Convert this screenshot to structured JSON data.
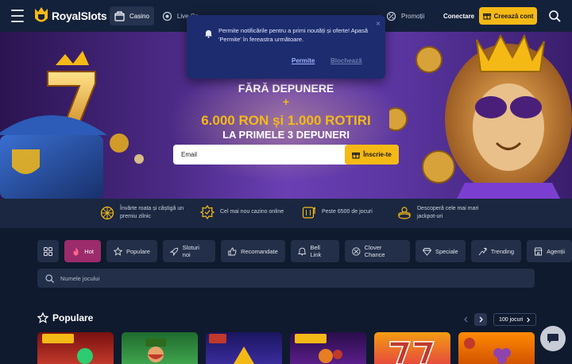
{
  "brand": {
    "name": "RoyalSlots"
  },
  "nav": {
    "items": [
      {
        "label": "Casino",
        "icon": "casino-icon"
      },
      {
        "label": "Live Ca",
        "icon": "live-casino-icon"
      },
      {
        "label": "Promoții",
        "icon": "promotions-icon"
      }
    ],
    "login_label": "Conectare",
    "register_label": "Creează cont"
  },
  "notification": {
    "text": "Permite notificările pentru a primi noutăți și oferte! Apasă 'Permite' în fereastra următoare.",
    "allow_label": "Permite",
    "block_label": "Blochează",
    "close_symbol": "×"
  },
  "hero": {
    "line1": "FĂRĂ DEPUNERE",
    "line2": "+",
    "line3": "6.000 RON și 1.000 ROTIRI",
    "line4": "LA PRIMELE 3 DEPUNERI",
    "email_placeholder": "Email",
    "signup_label": "Înscrie-te"
  },
  "features": [
    {
      "text": "Învârte roata și câștigă un premiu zilnic",
      "icon": "wheel-icon"
    },
    {
      "text": "Cel mai nou cazino online",
      "icon": "badge-icon"
    },
    {
      "text": "Peste 6500 de jocuri",
      "icon": "slot-machine-icon"
    },
    {
      "text": "Descoperă cele mai mari jackpot-uri",
      "icon": "jackpot-icon"
    }
  ],
  "categories": [
    {
      "label": "Hot",
      "icon": "fire-icon"
    },
    {
      "label": "Populare",
      "icon": "star-icon"
    },
    {
      "label": "Sloturi noi",
      "icon": "rocket-icon"
    },
    {
      "label": "Recomandate",
      "icon": "thumbs-up-icon"
    },
    {
      "label": "Bell Link",
      "icon": "bell-icon"
    },
    {
      "label": "Clover Chance",
      "icon": "clover-icon"
    },
    {
      "label": "Speciale",
      "icon": "diamond-icon"
    },
    {
      "label": "Trending",
      "icon": "trending-icon"
    },
    {
      "label": "Agenții",
      "icon": "store-icon"
    }
  ],
  "search": {
    "placeholder": "Numele jocului"
  },
  "section": {
    "title": "Populare",
    "all_label": "100 jocuri"
  },
  "colors": {
    "accent": "#f5b916",
    "hot": "#9c2b6b",
    "bg": "#0f1a2e"
  }
}
